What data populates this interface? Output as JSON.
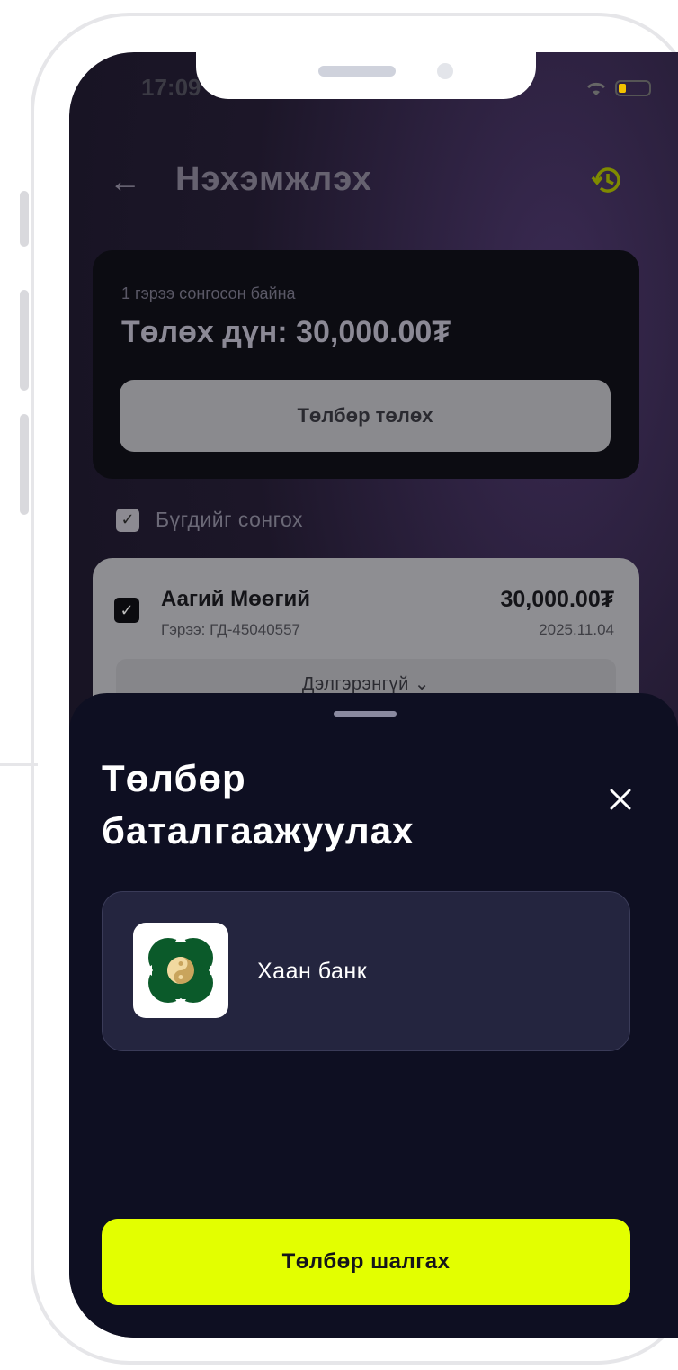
{
  "status_bar": {
    "time": "17:09"
  },
  "header": {
    "title": "Нэхэмжлэх"
  },
  "summary": {
    "selected_text": "1 гэрээ сонгосон байна",
    "amount_text": "Төлөх дүн: 30,000.00₮",
    "pay_button_label": "Төлбөр төлөх"
  },
  "select_all": {
    "label": "Бүгдийг сонгох",
    "checked": true
  },
  "contract": {
    "name": "Аагий Мөөгий",
    "contract_no": "Гэрээ: ГД-45040557",
    "amount": "30,000.00₮",
    "date": "2025.11.04",
    "details_label": "Дэлгэрэнгүй ⌄"
  },
  "sheet": {
    "title": "Төлбөр баталгаажуулах",
    "bank": {
      "name": "Хаан банк",
      "icon": "khan-bank-logo"
    },
    "check_button_label": "Төлбөр шалгах"
  },
  "colors": {
    "accent": "#E3FF00",
    "sheet_bg": "#0E0F22",
    "bank_green": "#0B5A2A"
  }
}
